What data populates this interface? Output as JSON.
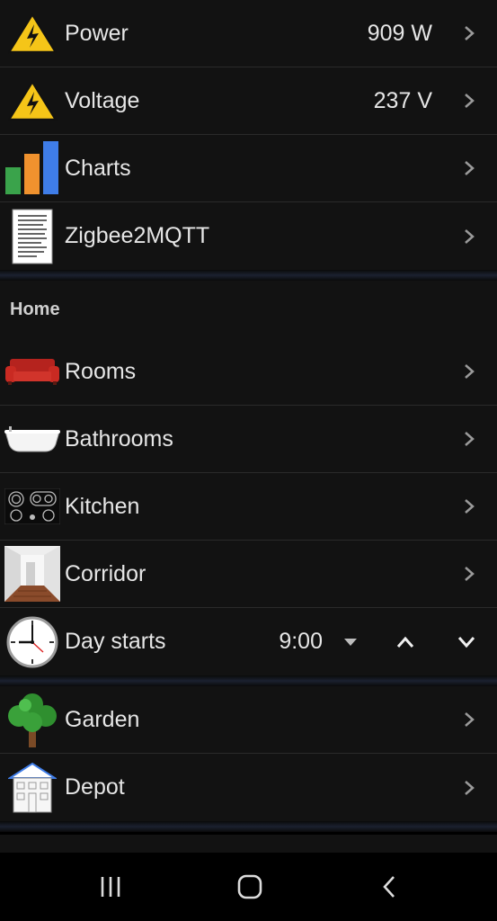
{
  "top_group": [
    {
      "label": "Power",
      "value": "909 W",
      "icon": "warning-voltage-icon"
    },
    {
      "label": "Voltage",
      "value": "237 V",
      "icon": "warning-voltage-icon"
    },
    {
      "label": "Charts",
      "icon": "bar-chart-icon"
    },
    {
      "label": "Zigbee2MQTT",
      "icon": "document-icon"
    }
  ],
  "home": {
    "title": "Home",
    "items": [
      {
        "label": "Rooms",
        "icon": "sofa-icon"
      },
      {
        "label": "Bathrooms",
        "icon": "bathtub-icon"
      },
      {
        "label": "Kitchen",
        "icon": "cooktop-icon"
      },
      {
        "label": "Corridor",
        "icon": "corridor-icon"
      }
    ],
    "day_starts": {
      "label": "Day starts",
      "value": "9:00",
      "icon": "clock-icon"
    }
  },
  "outdoor_group": [
    {
      "label": "Garden",
      "icon": "tree-icon"
    },
    {
      "label": "Depot",
      "icon": "house-icon"
    }
  ],
  "nav": {
    "buttons": [
      "recent-apps-icon",
      "home-icon",
      "back-icon"
    ]
  },
  "colors": {
    "background": "#121212",
    "text": "#e6e6e6",
    "accent_yellow": "#f5c518"
  }
}
